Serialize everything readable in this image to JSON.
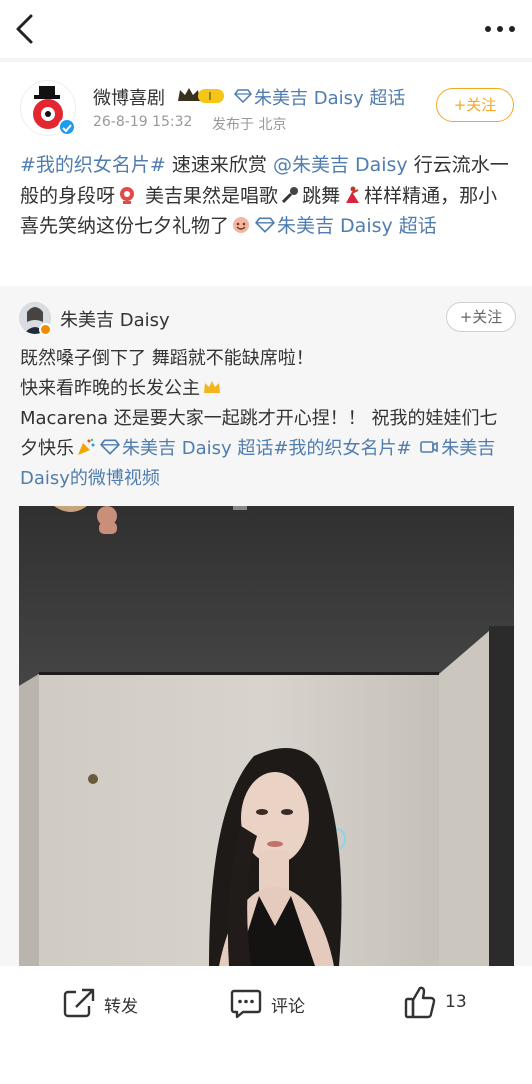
{
  "nav": {
    "back_icon": "chevron-left-icon",
    "more_icon": "more-dots-icon"
  },
  "author": {
    "name": "微博喜剧",
    "time": "26-8-19 15:32",
    "location": "发布于 北京",
    "super_topic": "朱美吉 Daisy 超话",
    "follow_label": "+关注",
    "badge_text": "I"
  },
  "post": {
    "hashtag": "#我的织女名片#",
    "text1": " 速速来欣赏 ",
    "mention": "@朱美吉 Daisy",
    "text2": " 行云流水一般的身段呀",
    "text3": " 美吉果然是唱歌",
    "text4": "跳舞",
    "text5": "样样精通，那小喜先笑纳这份七夕礼物了",
    "super_topic": "朱美吉 Daisy 超话"
  },
  "repost": {
    "name": "朱美吉 Daisy",
    "follow_label": "+关注",
    "line1": "既然嗓子倒下了 舞蹈就不能缺席啦！",
    "line2": "快来看昨晚的长发公主",
    "line3": " Macarena 还是要大家一起跳才开心捏！！ 祝我的娃娃们七夕快乐",
    "super_topic": "朱美吉 Daisy 超话",
    "hashtag": "#我的织女名片#",
    "video_link": "朱美吉 Daisy的微博视频"
  },
  "actions": {
    "repost_label": "转发",
    "comment_label": "评论",
    "like_count": "13"
  },
  "colors": {
    "link": "#507daf",
    "follow": "#f5a623"
  }
}
